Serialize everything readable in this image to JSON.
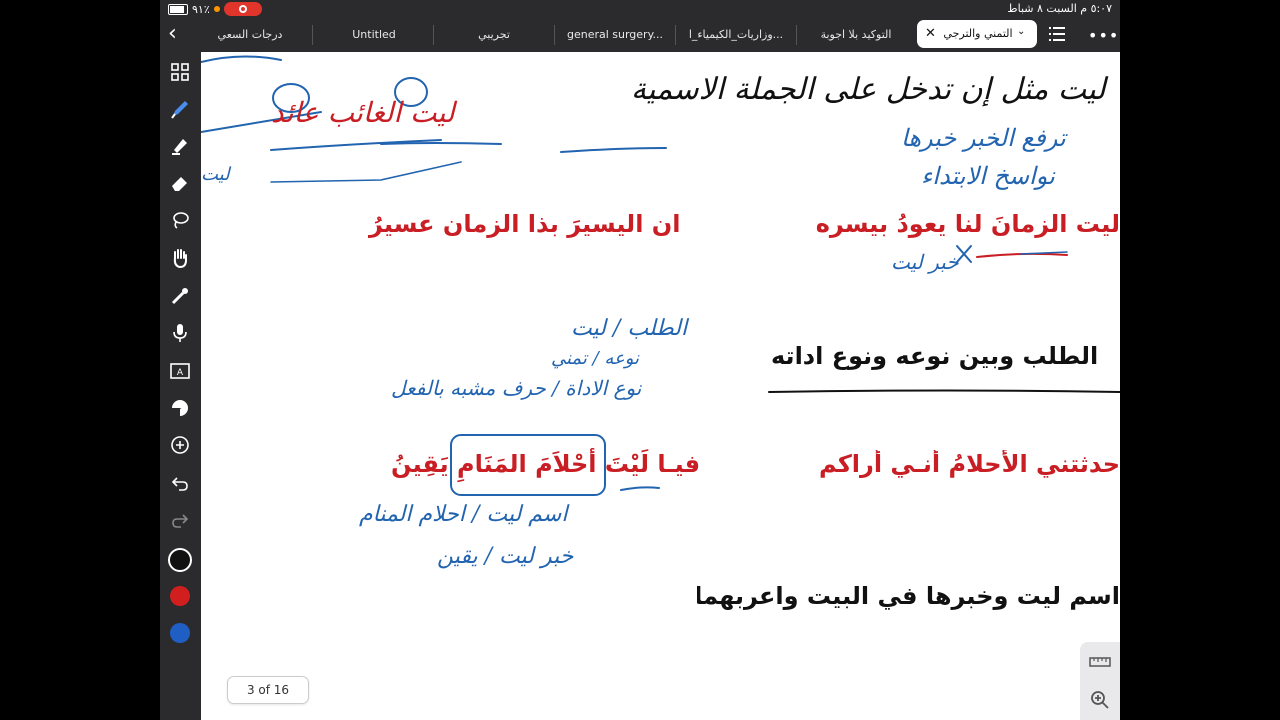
{
  "status_bar": {
    "battery_text": "٩١٪",
    "time_date": "٥:٠٧ م   السبت ٨ شباط"
  },
  "tabs": [
    {
      "label": "درجات السعي"
    },
    {
      "label": "Untitled"
    },
    {
      "label": "تجريبي"
    },
    {
      "label": "general surgery..."
    },
    {
      "label": "وزاريات_الكيمياء_ا..."
    },
    {
      "label": "التوكيد بلا اجوبة"
    }
  ],
  "active_tab": {
    "label": "التمني والترجي"
  },
  "colors": {
    "bar_bg": "#2b2b2d",
    "verse_red": "#c81e24",
    "ink_blue": "#2264b0",
    "swatch_black": "#111111",
    "swatch_red": "#d11f1f",
    "swatch_blue": "#1f5fc4"
  },
  "toolbar_icons": [
    "thumbnails-icon",
    "pen-icon",
    "highlighter-icon",
    "eraser-icon",
    "lasso-icon",
    "hand-icon",
    "laser-pointer-icon",
    "microphone-icon",
    "text-box-icon",
    "sticker-icon",
    "add-icon",
    "undo-icon",
    "redo-icon"
  ],
  "content": {
    "hw_top_left_red": "ليت الغائب عائد",
    "hw_top_right": "ليت مثل إن تدخل على الجملة الاسمية",
    "hw_right_1": "ترفع الخبر خبرها",
    "hw_right_2": "نواسخ الابتداء",
    "hw_left_small": "ليت",
    "verse1_right": "ليت الزمانَ لنا يعودُ بيسره",
    "verse1_left": "ان اليسيرَ بذا الزمان عسيرُ",
    "hw_under_verse1": "خبر ليت",
    "question1": "الطلب وبين نوعه ونوع اداته",
    "hw_q1_line1": "الطلب / ليت",
    "hw_q1_line2": "نوعه / تمني",
    "hw_q1_line3": "نوع الاداة / حرف مشبه بالفعل",
    "verse2_right": "حدثتني الأحلامُ أنـي أراكم",
    "verse2_left_part1": "فيـا لَيْتَ",
    "verse2_left_boxed": "أحْلاَمَ المَنَامِ",
    "verse2_left_part2": "يَقِينُ",
    "hw_q2_line1": "اسم ليت / احلام المنام",
    "hw_q2_line2": "خبر ليت / يقين",
    "question2": "اسم ليت وخبرها في البيت واعربهما",
    "page_indicator": "3 of 16"
  }
}
